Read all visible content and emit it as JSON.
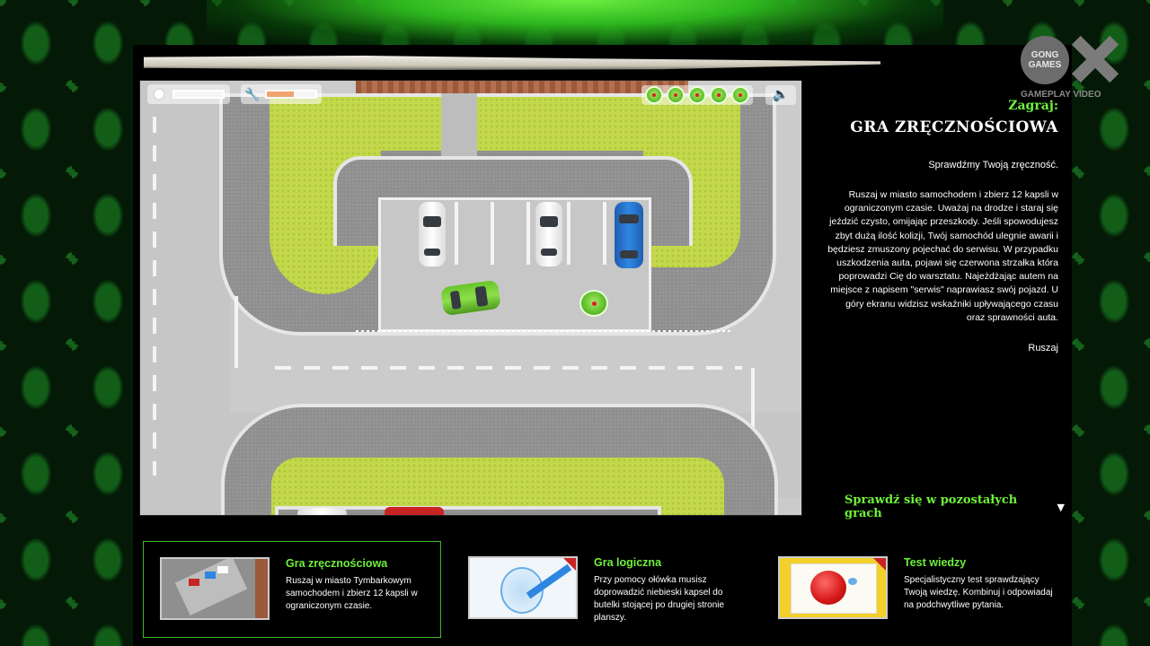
{
  "brand": {
    "logo_text": "GONG GAMES",
    "subtitle": "GAMEPLAY VIDEO"
  },
  "hud": {
    "time_fraction": 0.95,
    "damage_fraction": 0.55,
    "caps_count": 5,
    "sound_icon": "speaker-icon"
  },
  "side": {
    "label": "Zagraj:",
    "title": "GRA ZRĘCZNOŚCIOWA",
    "lead": "Sprawdźmy Twoją zręczność.",
    "description": "Ruszaj w miasto samochodem i zbierz 12 kapsli w ograniczonym czasie. Uważaj na drodze i staraj się jeździć czysto, omijając przeszkody. Jeśli spowodujesz zbyt dużą ilość kolizji, Twój samochód ulegnie awarii i będziesz zmuszony pojechać do serwisu. W przypadku uszkodzenia auta, pojawi się czerwona strzałka która poprowadzi Cię do warsztatu. Najeżdżając autem na miejsce z napisem \"serwis\" naprawiasz swój pojazd. U góry ekranu widzisz wskaźniki upływającego czasu oraz sprawności auta.",
    "go": "Ruszaj"
  },
  "more_games": "Sprawdź się w pozostałych grach",
  "cards": [
    {
      "title": "Gra zręcznościowa",
      "description": "Ruszaj w miasto Tymbarkowym samochodem i zbierz 12 kapsli w ograniczonym czasie."
    },
    {
      "title": "Gra logiczna",
      "description": "Przy pomocy ołówka musisz doprowadzić niebieski kapsel do butelki stojącej po drugiej stronie planszy."
    },
    {
      "title": "Test wiedzy",
      "description": "Specjalistyczny test sprawdzający Twoją wiedzę. Kombinuj i odpowiadaj na podchwytliwe pytania."
    }
  ],
  "colors": {
    "accent_green": "#6ff03c",
    "grass": "#c3d84a",
    "asphalt": "#8f8f8f"
  }
}
